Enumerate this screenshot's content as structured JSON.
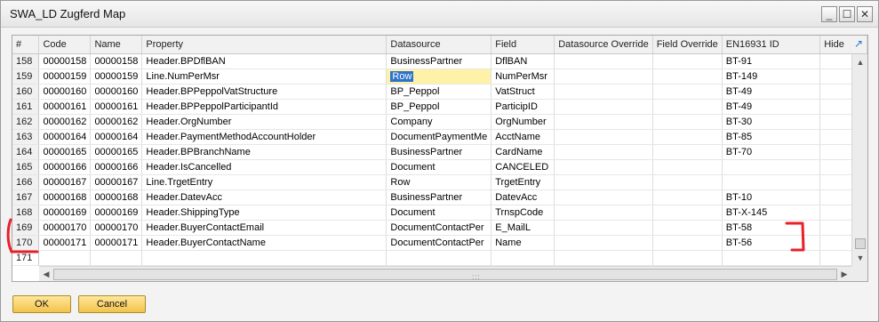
{
  "window": {
    "title": "SWA_LD Zugferd Map",
    "controls": {
      "minimize": "_",
      "maximize": "☐",
      "close": "✕"
    }
  },
  "grid": {
    "headers": [
      "#",
      "Code",
      "Name",
      "Property",
      "Datasource",
      "Field",
      "Datasource Override",
      "Field Override",
      "EN16931 ID",
      "Hide"
    ],
    "rows": [
      [
        "158",
        "00000158",
        "00000158",
        "Header.BPDflBAN",
        "BusinessPartner",
        "DflBAN",
        "",
        "",
        "BT-91",
        ""
      ],
      [
        "159",
        "00000159",
        "00000159",
        "Line.NumPerMsr",
        "Row",
        "NumPerMsr",
        "",
        "",
        "BT-149",
        ""
      ],
      [
        "160",
        "00000160",
        "00000160",
        "Header.BPPeppolVatStructure",
        "BP_Peppol",
        "VatStruct",
        "",
        "",
        "BT-49",
        ""
      ],
      [
        "161",
        "00000161",
        "00000161",
        "Header.BPPeppolParticipantId",
        "BP_Peppol",
        "ParticipID",
        "",
        "",
        "BT-49",
        ""
      ],
      [
        "162",
        "00000162",
        "00000162",
        "Header.OrgNumber",
        "Company",
        "OrgNumber",
        "",
        "",
        "BT-30",
        ""
      ],
      [
        "163",
        "00000164",
        "00000164",
        "Header.PaymentMethodAccountHolder",
        "DocumentPaymentMe",
        "AcctName",
        "",
        "",
        "BT-85",
        ""
      ],
      [
        "164",
        "00000165",
        "00000165",
        "Header.BPBranchName",
        "BusinessPartner",
        "CardName",
        "",
        "",
        "BT-70",
        ""
      ],
      [
        "165",
        "00000166",
        "00000166",
        "Header.IsCancelled",
        "Document",
        "CANCELED",
        "",
        "",
        "",
        ""
      ],
      [
        "166",
        "00000167",
        "00000167",
        "Line.TrgetEntry",
        "Row",
        "TrgetEntry",
        "",
        "",
        "",
        ""
      ],
      [
        "167",
        "00000168",
        "00000168",
        "Header.DatevAcc",
        "BusinessPartner",
        "DatevAcc",
        "",
        "",
        "BT-10",
        ""
      ],
      [
        "168",
        "00000169",
        "00000169",
        "Header.ShippingType",
        "Document",
        "TrnspCode",
        "",
        "",
        "BT-X-145",
        ""
      ],
      [
        "169",
        "00000170",
        "00000170",
        "Header.BuyerContactEmail",
        "DocumentContactPer",
        "E_MailL",
        "",
        "",
        "BT-58",
        ""
      ],
      [
        "170",
        "00000171",
        "00000171",
        "Header.BuyerContactName",
        "DocumentContactPer",
        "Name",
        "",
        "",
        "BT-56",
        ""
      ]
    ],
    "empty_row_number": "171",
    "selected_cell": {
      "row": 1,
      "col": 4
    },
    "expand_icon": "expand-arrow-icon",
    "hscroll_grip": ":::"
  },
  "buttons": {
    "ok": "OK",
    "cancel": "Cancel"
  },
  "colors": {
    "selection": "#2e73c9",
    "edit_highlight": "#fdf2a8",
    "button_gradient_top": "#ffe79a",
    "button_gradient_bottom": "#f3c24b",
    "annotation": "#e8202a"
  },
  "annotations": {
    "left_marker": "red-bracket",
    "right_marker": "red-bracket"
  }
}
